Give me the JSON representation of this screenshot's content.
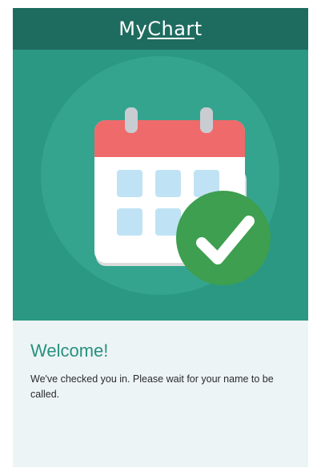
{
  "header": {
    "logo_prefix": "My",
    "logo_underlined": "Char",
    "logo_suffix": "t"
  },
  "illustration": {
    "icon": "calendar-check-icon",
    "colors": {
      "background": "#2a9883",
      "circle": "#34a48f",
      "calendar_top": "#ef6a6a",
      "calendar_body": "#ffffff",
      "cells": "#bfe3f4",
      "check_badge": "#3d9f4f"
    }
  },
  "welcome": {
    "title": "Welcome!",
    "message": "We've checked you in. Please wait for your name to be called."
  },
  "colors": {
    "header": "#1e6c5f",
    "accent": "#26917e",
    "panel": "#edf4f6"
  }
}
